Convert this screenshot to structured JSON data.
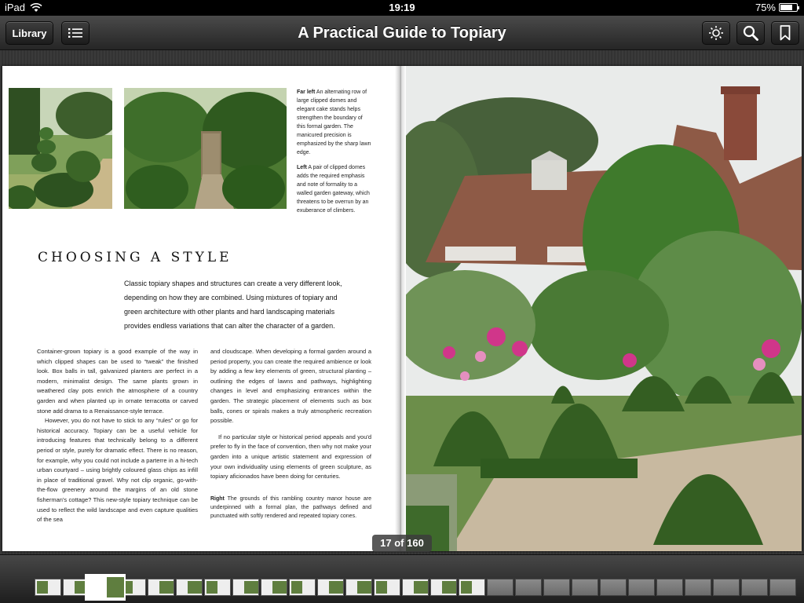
{
  "status_bar": {
    "device": "iPad",
    "time": "19:19",
    "battery": "75%",
    "battery_level": 0.75
  },
  "toolbar": {
    "library_label": "Library",
    "title": "A Practical Guide to Topiary"
  },
  "page": {
    "caption_far_left_lead": "Far left",
    "caption_far_left": "An alternating row of large clipped domes and elegant cake stands helps strengthen the boundary of this formal garden. The manicured precision is emphasized by the sharp lawn edge.",
    "caption_left_lead": "Left",
    "caption_left": "A pair of clipped domes adds the required emphasis and note of formality to a walled garden gateway, which threatens to be overrun by an exuberance of climbers.",
    "heading": "CHOOSING A STYLE",
    "intro": "Classic topiary shapes and structures can create a very different look, depending on how they are combined. Using mixtures of topiary and green architecture with other plants and hard landscaping materials provides endless variations that can alter the character of a garden.",
    "col1_p1": "Container-grown topiary is a good example of the way in which clipped shapes can be used to “tweak” the finished look. Box balls in tall, galvanized planters are perfect in a modern, minimalist design. The same plants grown in weathered clay pots enrich the atmosphere of a country garden and when planted up in ornate terracotta or carved stone add drama to a Renaissance-style terrace.",
    "col1_p2": "However, you do not have to stick to any “rules” or go for historical accuracy. Topiary can be a useful vehicle for introducing features that technically belong to a different period or style, purely for dramatic effect. There is no reason, for example, why you could not include a parterre in a hi-tech urban courtyard – using brightly coloured glass chips as infill in place of traditional gravel. Why not clip organic, go-with-the-flow greenery around the margins of an old stone fisherman's cottage? This new-style topiary technique can be used to reflect the wild landscape and even capture qualities of the sea",
    "col2_p1": "and cloudscape. When developing a formal garden around a period property, you can create the required ambience or look by adding a few key elements of green, structural planting – outlining the edges of lawns and pathways, highlighting changes in level and emphasizing entrances within the garden. The strategic placement of elements such as box balls, cones or spirals makes a truly atmospheric recreation possible.",
    "col2_p2": "If no particular style or historical period appeals and you'd prefer to fly in the face of convention, then why not make your garden into a unique artistic statement and expression of your own individuality using elements of green sculpture, as topiary aficionados have been doing for centuries.",
    "caption_right_lead": "Right",
    "caption_right": "The grounds of this rambling country manor house are underpinned with a formal plan, the pathways defined and punctuated with softly rendered and repeated topiary cones."
  },
  "page_indicator": "17 of 160",
  "thumbnails": {
    "filled_count": 16,
    "empty_count": 11,
    "current_index": 2
  }
}
